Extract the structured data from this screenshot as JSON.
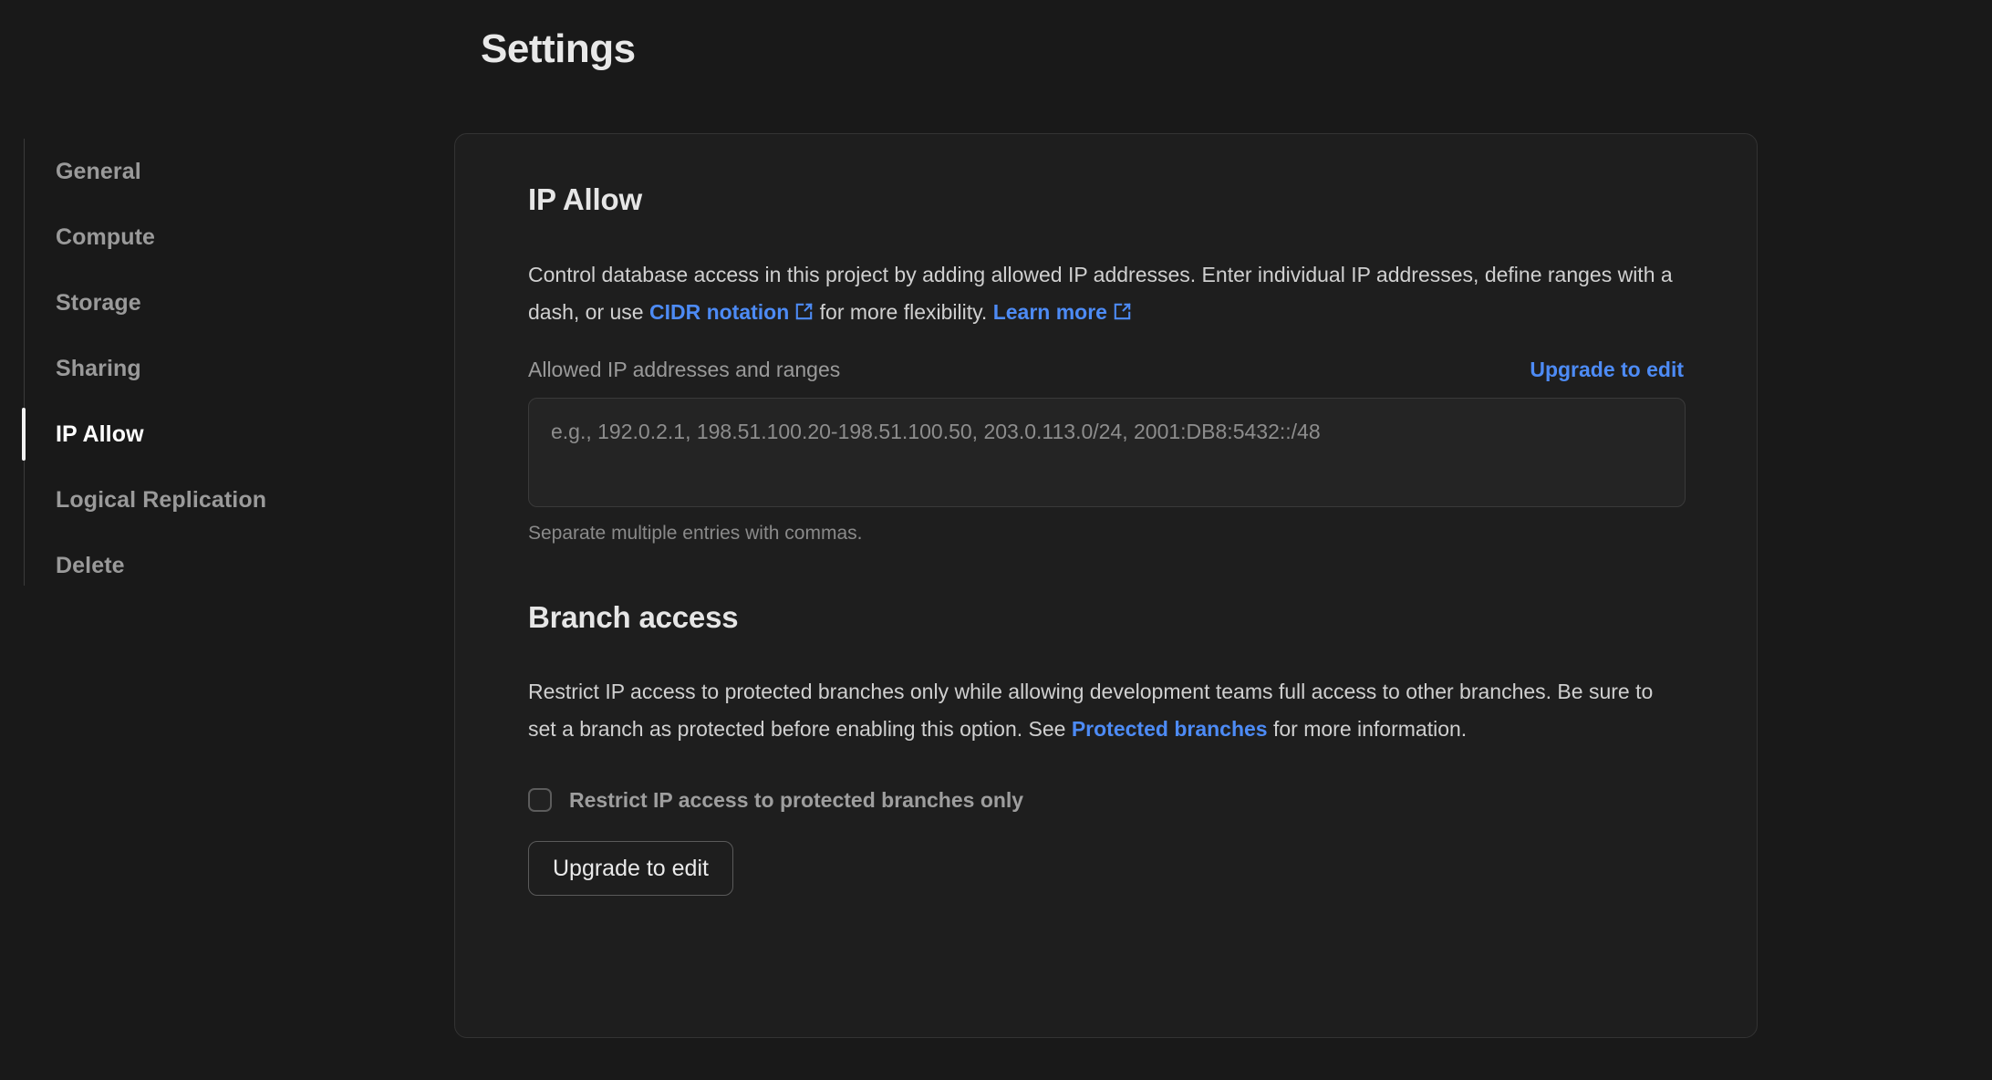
{
  "header": {
    "title": "Settings"
  },
  "sidebar": {
    "items": [
      {
        "label": "General",
        "active": false
      },
      {
        "label": "Compute",
        "active": false
      },
      {
        "label": "Storage",
        "active": false
      },
      {
        "label": "Sharing",
        "active": false
      },
      {
        "label": "IP Allow",
        "active": true
      },
      {
        "label": "Logical Replication",
        "active": false
      },
      {
        "label": "Delete",
        "active": false
      }
    ]
  },
  "ip_allow": {
    "title": "IP Allow",
    "description_part1": "Control database access in this project by adding allowed IP addresses. Enter individual IP addresses, define ranges with a dash, or use ",
    "cidr_link": "CIDR notation",
    "description_part2": " for more flexibility. ",
    "learn_more_link": "Learn more",
    "field_label": "Allowed IP addresses and ranges",
    "upgrade_link": "Upgrade to edit",
    "textarea_value": "",
    "textarea_placeholder": "e.g., 192.0.2.1, 198.51.100.20-198.51.100.50, 203.0.113.0/24, 2001:DB8:5432::/48",
    "helper_text": "Separate multiple entries with commas."
  },
  "branch_access": {
    "title": "Branch access",
    "description_part1": "Restrict IP access to protected branches only while allowing development teams full access to other branches. Be sure to set a branch as protected before enabling this option. See ",
    "protected_branches_link": "Protected branches",
    "description_part2": " for more information.",
    "checkbox_label": "Restrict IP access to protected branches only",
    "checkbox_checked": false,
    "button_label": "Upgrade to edit"
  },
  "icons": {
    "external_link": "external-link-icon"
  },
  "colors": {
    "page_background": "#191919",
    "card_background": "#1e1e1e",
    "card_border": "#333333",
    "link": "#4d8bf5",
    "text_primary": "#e3e3e3",
    "text_muted": "#9a9a9a",
    "active_indicator": "#f2f2f2"
  }
}
